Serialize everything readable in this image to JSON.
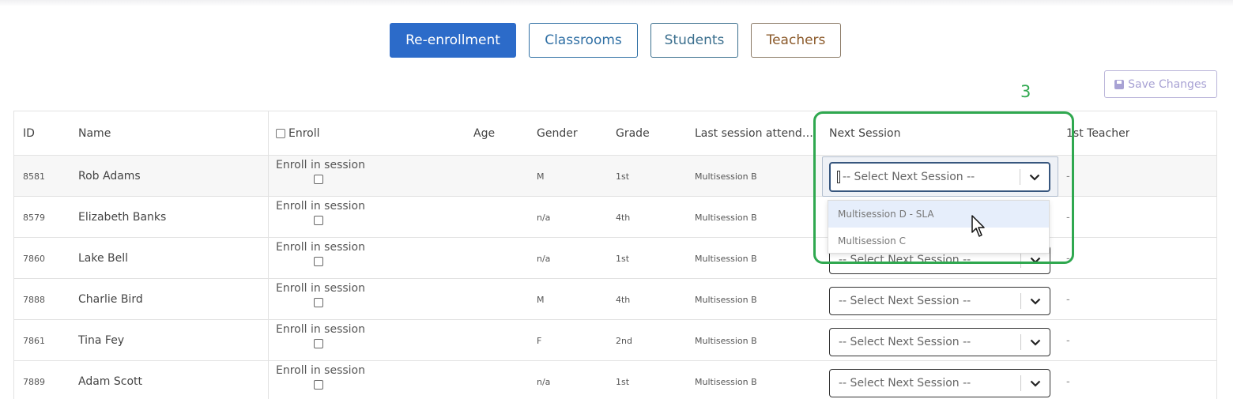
{
  "tabs": {
    "reenrollment": "Re-enrollment",
    "classrooms": "Classrooms",
    "students": "Students",
    "teachers": "Teachers"
  },
  "save_button": {
    "label": "Save Changes",
    "icon": "floppy-disk-icon"
  },
  "annotation": {
    "number": "3",
    "color": "#2fa84f"
  },
  "table": {
    "headers": {
      "id": "ID",
      "name": "Name",
      "enroll": "Enroll",
      "age": "Age",
      "gender": "Gender",
      "grade": "Grade",
      "last_session": "Last session attend…",
      "next_session": "Next Session",
      "first_teacher": "1st Teacher"
    },
    "rows": [
      {
        "id": "8581",
        "name": "Rob Adams",
        "enroll_label": "Enroll in session",
        "gender": "M",
        "grade": "1st",
        "last_session": "Multisession B",
        "next_session": "-- Select Next Session --",
        "teacher": "-"
      },
      {
        "id": "8579",
        "name": "Elizabeth Banks",
        "enroll_label": "Enroll in session",
        "gender": "n/a",
        "grade": "4th",
        "last_session": "Multisession B",
        "next_session": "",
        "teacher": "-"
      },
      {
        "id": "7860",
        "name": "Lake Bell",
        "enroll_label": "Enroll in session",
        "gender": "n/a",
        "grade": "1st",
        "last_session": "Multisession B",
        "next_session": "-- Select Next Session --",
        "teacher": "-"
      },
      {
        "id": "7888",
        "name": "Charlie Bird",
        "enroll_label": "Enroll in session",
        "gender": "M",
        "grade": "4th",
        "last_session": "Multisession B",
        "next_session": "-- Select Next Session --",
        "teacher": "-"
      },
      {
        "id": "7861",
        "name": "Tina Fey",
        "enroll_label": "Enroll in session",
        "gender": "F",
        "grade": "2nd",
        "last_session": "Multisession B",
        "next_session": "-- Select Next Session --",
        "teacher": "-"
      },
      {
        "id": "7889",
        "name": "Adam Scott",
        "enroll_label": "Enroll in session",
        "gender": "n/a",
        "grade": "1st",
        "last_session": "Multisession B",
        "next_session": "-- Select Next Session --",
        "teacher": "-"
      }
    ]
  },
  "dropdown_menu": {
    "options": [
      "Multisession D - SLA",
      "Multisession C"
    ],
    "hovered": "Multisession D - SLA"
  },
  "colors": {
    "primary": "#2c6bc9",
    "annotation_green": "#2fa84f",
    "save_disabled": "#a8a2d4"
  }
}
